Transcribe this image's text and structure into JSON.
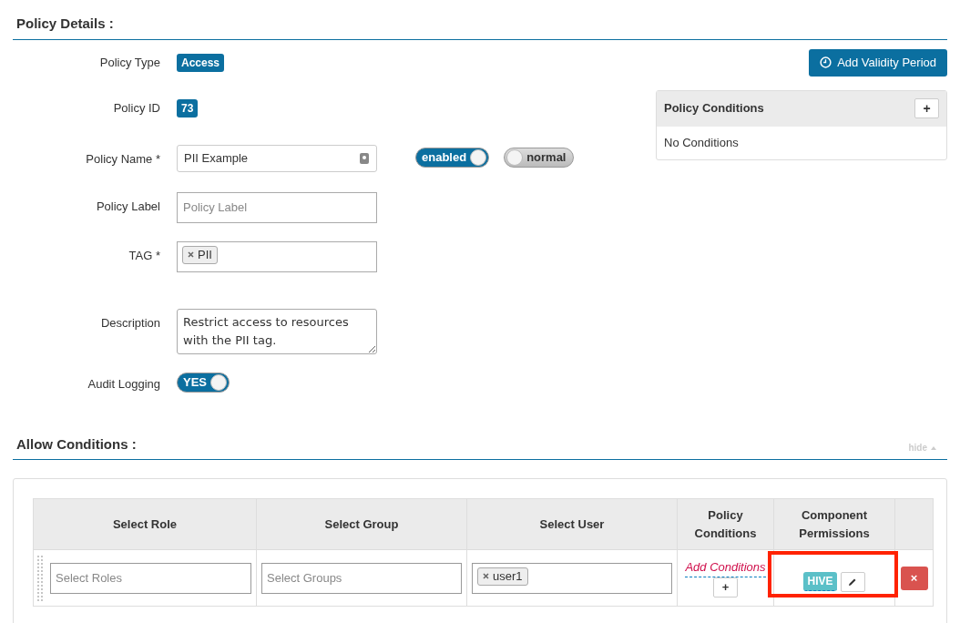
{
  "policy_details": {
    "title": "Policy Details :",
    "fields": [
      {
        "kind": "badge",
        "label": "Policy Type",
        "value": "Access"
      },
      {
        "kind": "badge",
        "label": "Policy ID",
        "value": "73"
      },
      {
        "kind": "text",
        "label": "Policy Name *",
        "value": "PII Example",
        "toggles": [
          {
            "label": "enabled",
            "on": true
          },
          {
            "label": "normal",
            "on": false
          }
        ]
      },
      {
        "kind": "text",
        "label": "Policy Label",
        "placeholder": "Policy Label"
      },
      {
        "kind": "tags",
        "label": "TAG *",
        "tags": [
          "PII"
        ]
      },
      {
        "kind": "textarea",
        "label": "Description",
        "value": "Restrict access to resources with the PII tag."
      },
      {
        "kind": "switch",
        "label": "Audit Logging",
        "switch": {
          "label": "YES",
          "on": true
        }
      }
    ],
    "validity_button": "Add Validity Period",
    "conditions_panel": {
      "title": "Policy Conditions",
      "add": "+",
      "empty": "No Conditions"
    }
  },
  "allow_conditions": {
    "title": "Allow Conditions :",
    "hide": "hide",
    "columns": [
      "Select Role",
      "Select Group",
      "Select User",
      "Policy Conditions",
      "Component Permissions"
    ],
    "rows": [
      {
        "role_placeholder": "Select Roles",
        "group_placeholder": "Select Groups",
        "users": [
          "user1"
        ],
        "add_conditions": "Add Conditions",
        "add": "+",
        "component": "HIVE",
        "remove": "×",
        "highlighted": true
      }
    ]
  }
}
